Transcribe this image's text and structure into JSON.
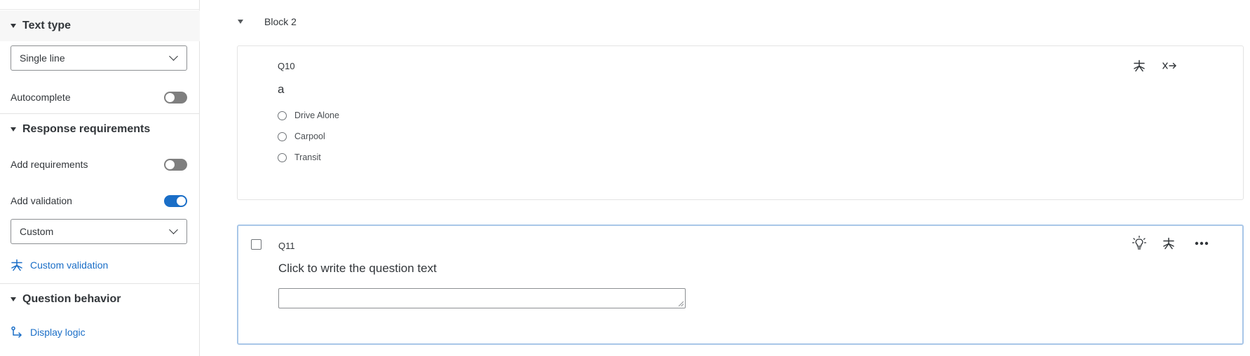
{
  "sidebar": {
    "text_type": {
      "title": "Text type",
      "select_value": "Single line",
      "autocomplete_label": "Autocomplete",
      "autocomplete_on": false
    },
    "response_requirements": {
      "title": "Response requirements",
      "add_requirements_label": "Add requirements",
      "add_requirements_on": false,
      "add_validation_label": "Add validation",
      "add_validation_on": true,
      "validation_select_value": "Custom",
      "custom_validation_link": "Custom validation"
    },
    "question_behavior": {
      "title": "Question behavior",
      "display_logic_link": "Display logic"
    }
  },
  "main": {
    "block_title": "Block 2",
    "questions": [
      {
        "number": "Q10",
        "text": "a",
        "choices": [
          "Drive Alone",
          "Carpool",
          "Transit"
        ],
        "toolbar_icons": [
          "asterisk-icon",
          "skip-arrow-icon"
        ]
      },
      {
        "number": "Q11",
        "text": "Click to write the question text",
        "toolbar_icons": [
          "lightbulb-icon",
          "asterisk-icon",
          "more-icon"
        ]
      }
    ]
  },
  "colors": {
    "accent": "#1a6ec7",
    "selected_border": "#a8c6e8",
    "toggle_off": "#7f7f7f"
  }
}
